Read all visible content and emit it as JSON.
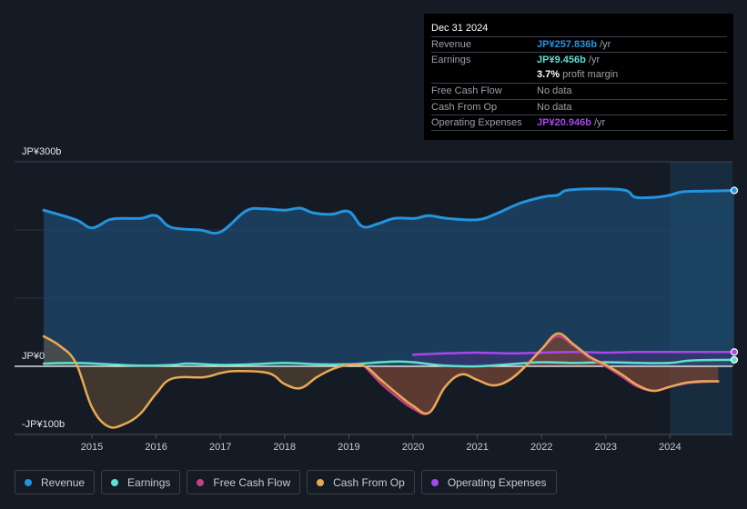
{
  "tooltip": {
    "date": "Dec 31 2024",
    "rows": [
      {
        "label": "Revenue",
        "value": "JP¥257.836b",
        "suffix": " /yr",
        "color": "#2394df"
      },
      {
        "label": "Earnings",
        "value": "JP¥9.456b",
        "suffix": " /yr",
        "color": "#5ee0cf"
      },
      {
        "label": "",
        "value": "3.7%",
        "suffix": " profit margin",
        "color": "#ffffff"
      },
      {
        "label": "Free Cash Flow",
        "value": "",
        "suffix": "No data",
        "color": "#9aa0a8"
      },
      {
        "label": "Cash From Op",
        "value": "",
        "suffix": "No data",
        "color": "#9aa0a8"
      },
      {
        "label": "Operating Expenses",
        "value": "JP¥20.946b",
        "suffix": " /yr",
        "color": "#a648ec"
      }
    ]
  },
  "legend": [
    {
      "label": "Revenue",
      "color": "#2394df"
    },
    {
      "label": "Earnings",
      "color": "#5ee0cf"
    },
    {
      "label": "Free Cash Flow",
      "color": "#c2427f"
    },
    {
      "label": "Cash From Op",
      "color": "#e8a955"
    },
    {
      "label": "Operating Expenses",
      "color": "#a648ec"
    }
  ],
  "chart_data": {
    "type": "area",
    "title": "",
    "xlabel": "",
    "ylabel": "",
    "y_tick_labels": [
      {
        "value": 300,
        "label": "JP¥300b"
      },
      {
        "value": 0,
        "label": "JP¥0"
      },
      {
        "value": -100,
        "label": "-JP¥100b"
      }
    ],
    "ylim": [
      -100,
      300
    ],
    "xlim": [
      2014.25,
      2025.0
    ],
    "x_ticks": [
      2015,
      2016,
      2017,
      2018,
      2019,
      2020,
      2021,
      2022,
      2023,
      2024
    ],
    "highlight_from": 2024.0,
    "grid": true,
    "legend_position": "bottom",
    "units": "JP¥ billions",
    "series": [
      {
        "name": "Revenue",
        "color": "#2394df",
        "x": [
          2014.25,
          2014.75,
          2015.0,
          2015.27,
          2015.48,
          2015.76,
          2016.0,
          2016.23,
          2016.68,
          2017.0,
          2017.4,
          2017.68,
          2018.0,
          2018.24,
          2018.45,
          2018.73,
          2019.0,
          2019.21,
          2019.45,
          2019.71,
          2020.03,
          2020.24,
          2020.53,
          2021.0,
          2021.3,
          2021.66,
          2022.05,
          2022.25,
          2022.46,
          2023.25,
          2023.46,
          2023.77,
          2023.99,
          2024.2,
          2024.55,
          2025.0
        ],
        "values": [
          229,
          215,
          203,
          215,
          217,
          217,
          221,
          204,
          200,
          197,
          228,
          231,
          229,
          232,
          225,
          223,
          227,
          205,
          209,
          217,
          217,
          221,
          217,
          215,
          224,
          239,
          249,
          251,
          259,
          259,
          248,
          248,
          251,
          256,
          257,
          258
        ]
      },
      {
        "name": "Earnings",
        "color": "#5ee0cf",
        "x": [
          2014.25,
          2014.75,
          2015.25,
          2015.75,
          2016.25,
          2016.5,
          2017.0,
          2017.5,
          2018.0,
          2018.5,
          2019.0,
          2019.5,
          2019.75,
          2020.0,
          2020.5,
          2021.0,
          2021.5,
          2022.0,
          2022.5,
          2023.0,
          2023.5,
          2024.0,
          2024.25,
          2024.5,
          2025.0
        ],
        "values": [
          4,
          5,
          3,
          1,
          2,
          4,
          2,
          3,
          5,
          3,
          3,
          6,
          7,
          6,
          1,
          0,
          3,
          6,
          5,
          6,
          5,
          5,
          8,
          9,
          9.5
        ]
      },
      {
        "name": "Free Cash Flow",
        "color": "#c2427f",
        "x": [
          2019.25,
          2019.5,
          2019.75,
          2020.0,
          2020.25,
          2020.5,
          2020.75,
          2021.0,
          2021.25,
          2021.5,
          2021.75,
          2022.0,
          2022.25,
          2022.5,
          2022.75,
          2023.0,
          2023.25,
          2023.5,
          2023.75,
          2024.0,
          2024.25,
          2024.5,
          2024.75
        ],
        "values": [
          0,
          -25,
          -45,
          -62,
          -68,
          -30,
          -12,
          -20,
          -28,
          -20,
          0,
          25,
          44,
          30,
          12,
          0,
          -15,
          -30,
          -36,
          -30,
          -25,
          -23,
          -22
        ]
      },
      {
        "name": "Cash From Op",
        "color": "#e8a955",
        "x": [
          2014.25,
          2014.5,
          2014.75,
          2015.0,
          2015.25,
          2015.5,
          2015.75,
          2016.0,
          2016.25,
          2016.75,
          2017.0,
          2017.25,
          2017.75,
          2018.0,
          2018.25,
          2018.5,
          2018.75,
          2019.0,
          2019.25,
          2019.5,
          2019.75,
          2020.0,
          2020.25,
          2020.5,
          2020.75,
          2021.0,
          2021.25,
          2021.5,
          2021.75,
          2022.0,
          2022.25,
          2022.5,
          2022.75,
          2023.0,
          2023.25,
          2023.5,
          2023.75,
          2024.0,
          2024.25,
          2024.5,
          2024.75
        ],
        "values": [
          44,
          30,
          5,
          -60,
          -88,
          -85,
          -70,
          -40,
          -18,
          -16,
          -10,
          -7,
          -10,
          -26,
          -32,
          -16,
          -4,
          2,
          0,
          -20,
          -40,
          -58,
          -68,
          -30,
          -12,
          -20,
          -28,
          -20,
          0,
          25,
          48,
          32,
          14,
          2,
          -12,
          -28,
          -36,
          -30,
          -24,
          -22,
          -22
        ]
      },
      {
        "name": "Operating Expenses",
        "color": "#a648ec",
        "x": [
          2020.0,
          2020.5,
          2021.0,
          2021.5,
          2022.0,
          2022.5,
          2023.0,
          2023.5,
          2024.0,
          2024.5,
          2025.0
        ],
        "values": [
          17,
          19,
          20,
          19,
          20,
          21,
          20,
          21,
          21,
          21,
          21
        ]
      }
    ]
  }
}
